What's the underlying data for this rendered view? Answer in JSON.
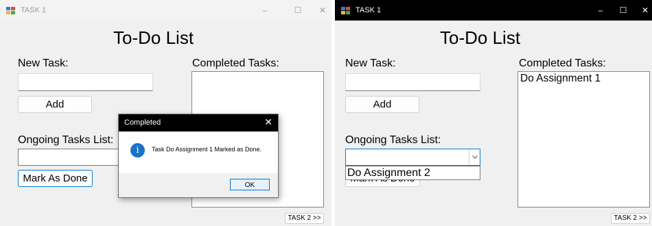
{
  "window_a": {
    "title": "TASK 1",
    "controls": {
      "minimize": "–",
      "maximize": "☐",
      "close": "✕"
    },
    "form_title": "To-Do List",
    "new_task_label": "New Task:",
    "new_task_value": "",
    "add_label": "Add",
    "completed_label": "Completed Tasks:",
    "ongoing_label": "Ongoing Tasks List:",
    "ongoing_value": "",
    "mark_done_label": "Mark As Done",
    "nav_label": "TASK 2 >>",
    "dialog": {
      "title": "Completed",
      "close": "✕",
      "message": "Task Do Assignment 1 Marked as Done.",
      "ok_label": "OK",
      "icon": "info-icon"
    }
  },
  "window_b": {
    "title": "TASK 1",
    "controls": {
      "minimize": "–",
      "maximize": "☐",
      "close": "✕"
    },
    "form_title": "To-Do List",
    "new_task_label": "New Task:",
    "new_task_value": "",
    "add_label": "Add",
    "completed_label": "Completed Tasks:",
    "completed_items": [
      "Do Assignment 1"
    ],
    "ongoing_label": "Ongoing Tasks List:",
    "ongoing_value": "",
    "dropdown_items": [
      "Do Assignment 2"
    ],
    "mark_done_label": "Mark As Done",
    "nav_label": "TASK 2 >>"
  }
}
